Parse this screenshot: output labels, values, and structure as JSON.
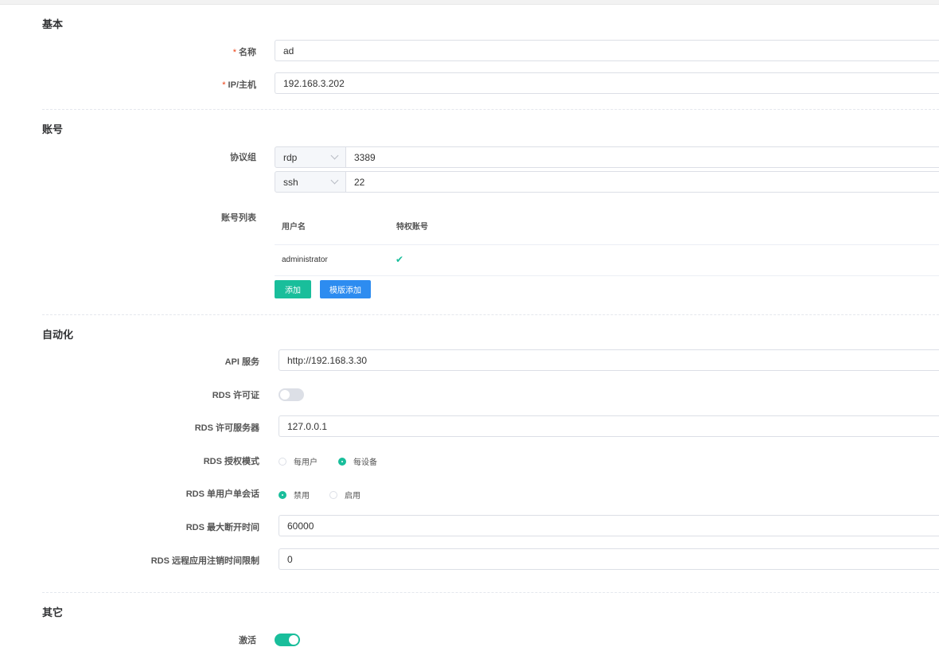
{
  "sections": {
    "basic": "基本",
    "account": "账号",
    "automation": "自动化",
    "other": "其它"
  },
  "basic": {
    "name_label": "名称",
    "name_value": "ad",
    "host_label": "IP/主机",
    "host_value": "192.168.3.202",
    "required_mark": "*"
  },
  "account": {
    "protocol_label": "协议组",
    "protocols": [
      {
        "name": "rdp",
        "port": "3389"
      },
      {
        "name": "ssh",
        "port": "22"
      }
    ],
    "list_label": "账号列表",
    "columns": [
      "用户名",
      "特权账号"
    ],
    "rows": [
      {
        "username": "administrator",
        "privileged": "✔"
      }
    ],
    "add_button": "添加",
    "template_add_button": "模版添加"
  },
  "automation": {
    "api_label": "API 服务",
    "api_value": "http://192.168.3.30",
    "rds_license_label": "RDS 许可证",
    "rds_license_on": false,
    "rds_server_label": "RDS 许可服务器",
    "rds_server_value": "127.0.0.1",
    "rds_mode_label": "RDS 授权模式",
    "rds_mode_options": [
      "每用户",
      "每设备"
    ],
    "rds_mode_selected": "每设备",
    "rds_single_label": "RDS 单用户单会话",
    "rds_single_options": [
      "禁用",
      "启用"
    ],
    "rds_single_selected": "禁用",
    "rds_max_disconnect_label": "RDS 最大断开时间",
    "rds_max_disconnect_value": "60000",
    "rds_logoff_label": "RDS 远程应用注销时间限制",
    "rds_logoff_value": "0"
  },
  "other": {
    "active_label": "激活",
    "active_on": true
  },
  "colors": {
    "primary": "#19be9b",
    "info": "#2d8cf0",
    "switch_off": "#dcdfe6"
  }
}
